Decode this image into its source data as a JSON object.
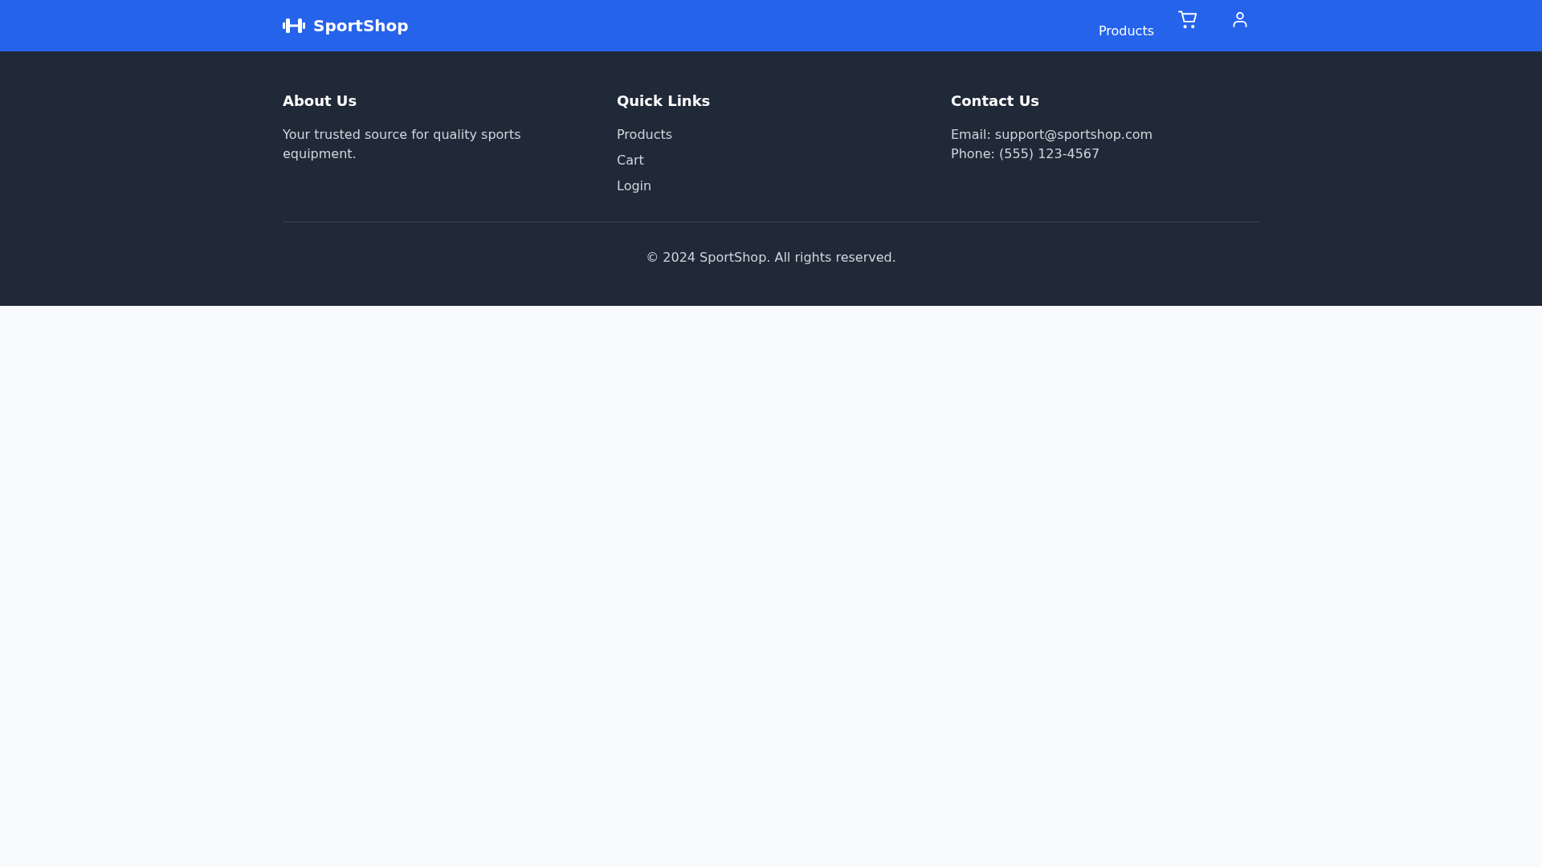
{
  "header": {
    "brand": "SportShop",
    "nav_links": [
      "Products"
    ]
  },
  "footer": {
    "columns": [
      {
        "kind": "text",
        "title": "About Us",
        "text": "Your trusted source for quality sports equipment."
      },
      {
        "kind": "links",
        "title": "Quick Links",
        "links": [
          "Products",
          "Cart",
          "Login"
        ]
      },
      {
        "kind": "lines",
        "title": "Contact Us",
        "lines": [
          "Email: support@sportshop.com",
          "Phone: (555) 123-4567"
        ]
      }
    ],
    "copyright": "© 2024 SportShop. All rights reserved."
  }
}
